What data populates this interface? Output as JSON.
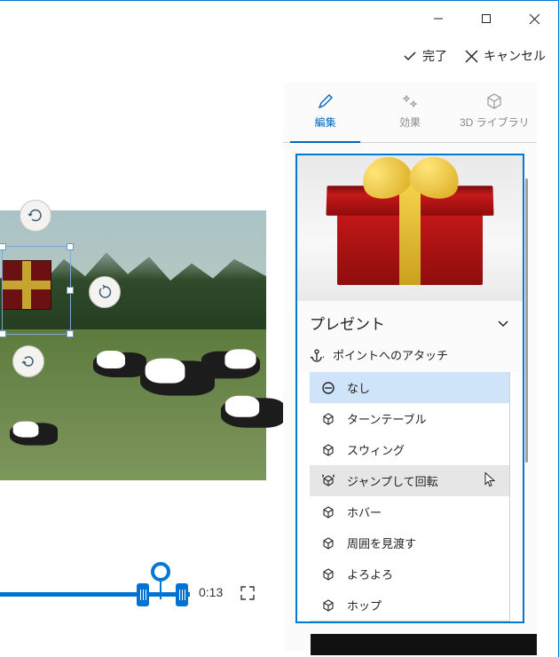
{
  "window": {
    "minimize": "–",
    "maximize": "□",
    "close": "×"
  },
  "header": {
    "done": "完了",
    "cancel": "キャンセル"
  },
  "tabs": {
    "edit": "編集",
    "effects": "効果",
    "library": "3D ライブラリ"
  },
  "effect": {
    "title": "プレゼント",
    "attach_label": "ポイントへのアタッチ",
    "options": [
      {
        "label": "なし",
        "icon": "none-icon",
        "state": "active"
      },
      {
        "label": "ターンテーブル",
        "icon": "cube-icon",
        "state": ""
      },
      {
        "label": "スウィング",
        "icon": "cube-icon",
        "state": ""
      },
      {
        "label": "ジャンプして回転",
        "icon": "cube-jump-icon",
        "state": "hover"
      },
      {
        "label": "ホバー",
        "icon": "cube-icon",
        "state": ""
      },
      {
        "label": "周囲を見渡す",
        "icon": "cube-icon",
        "state": ""
      },
      {
        "label": "よろよろ",
        "icon": "cube-icon",
        "state": ""
      },
      {
        "label": "ホップ",
        "icon": "cube-icon",
        "state": ""
      }
    ]
  },
  "timeline": {
    "current_time": "0:13"
  },
  "colors": {
    "accent": "#0078d4",
    "selected_row": "#cfe4f8",
    "hover_row": "#e6e6e6"
  }
}
